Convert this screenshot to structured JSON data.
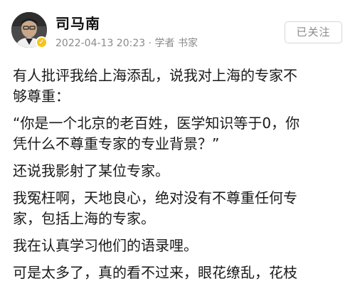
{
  "post": {
    "author": {
      "name": "司马南",
      "avatar_icon": "person-avatar-icon",
      "verified_icon": "verified-badge-icon",
      "verified_color": "#f5c518"
    },
    "meta": {
      "datetime": "2022-04-13 20:23",
      "separator": "·",
      "tags": "学者 书家"
    },
    "follow_label": "已关注",
    "paragraphs": [
      [
        "有人批评我给上海添乱，说我对上海的专家不",
        "够尊重："
      ],
      [
        "“你是一个北京的老百姓，医学知识等于0，你",
        "凭什么不尊重专家的专业背景？”"
      ],
      [
        "还说我影射了某位专家。"
      ],
      [
        "我冤枉啊，天地良心，绝对没有不尊重任何专",
        "家，包括上海的专家。"
      ],
      [
        "我在认真学习他们的语录哩。"
      ],
      [
        "可是太多了，真的看不过来，眼花缭乱，花枝"
      ]
    ]
  }
}
